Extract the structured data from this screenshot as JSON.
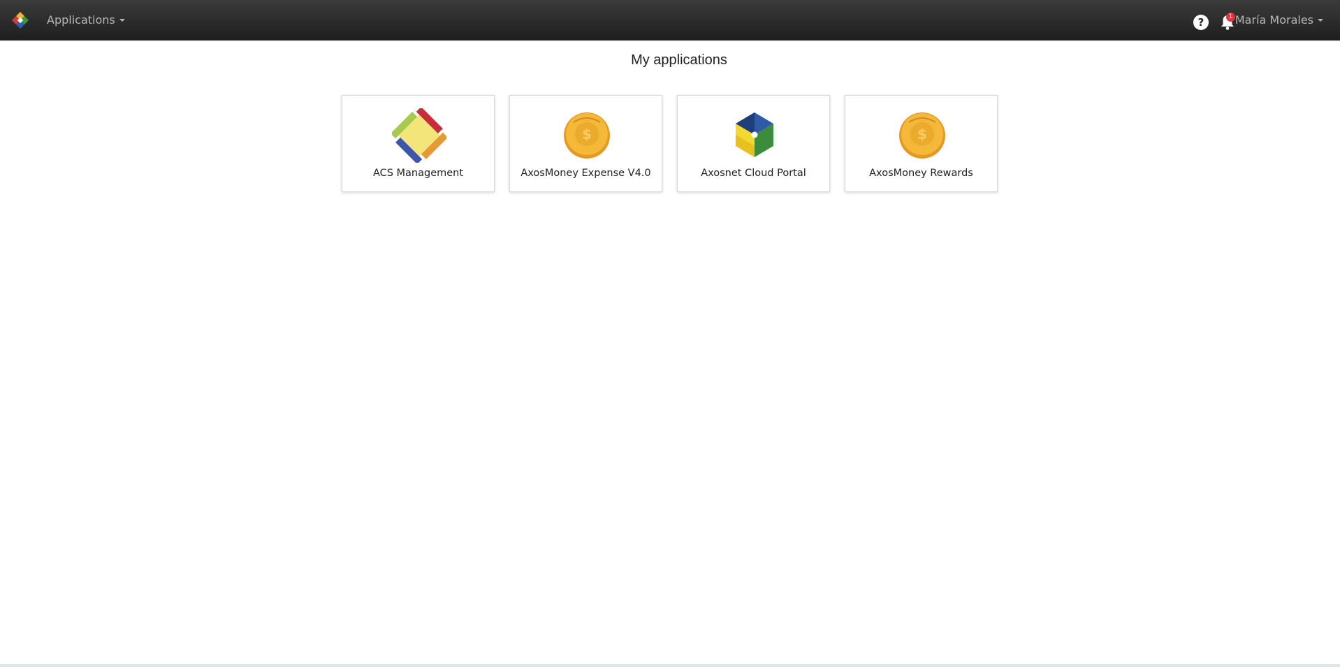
{
  "navbar": {
    "brand_icon": "axosnet-logo-icon",
    "apps_menu_label": "Applications",
    "help_icon_label": "?",
    "notification_count": "1",
    "user_name": "María Morales"
  },
  "main": {
    "title": "My applications",
    "apps": [
      {
        "label": "ACS Management",
        "icon": "acs-management-logo-icon"
      },
      {
        "label": "AxosMoney Expense V4.0",
        "icon": "axosmoney-coin-icon"
      },
      {
        "label": "Axosnet Cloud Portal",
        "icon": "axosnet-cube-icon"
      },
      {
        "label": "AxosMoney Rewards",
        "icon": "axosmoney-coin-icon"
      }
    ]
  },
  "colors": {
    "navbar_top": "#3b3b3b",
    "navbar_bottom": "#1e1e1e",
    "badge": "#d9383c",
    "coin": "#f2b233"
  }
}
